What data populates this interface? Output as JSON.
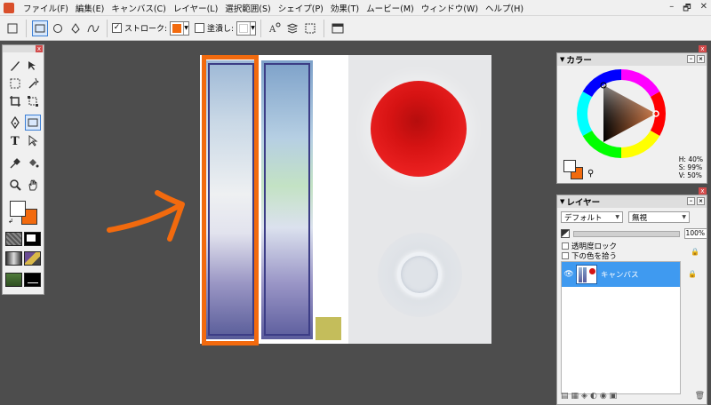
{
  "menu": {
    "items": [
      "ファイル(F)",
      "編集(E)",
      "キャンバス(C)",
      "レイヤー(L)",
      "選択範囲(S)",
      "シェイプ(P)",
      "効果(T)",
      "ムービー(M)",
      "ウィンドウ(W)",
      "ヘルプ(H)"
    ]
  },
  "window_controls": {
    "minimize": "–",
    "restore": "🗗",
    "close": "✕"
  },
  "options_bar": {
    "stroke_label": "ストローク:",
    "stroke_checked": "✓",
    "fill_label": "塗潰し:"
  },
  "colors": {
    "stroke": "#f26a0e",
    "fill": "#ffffff",
    "foreground": "#ffffff",
    "background": "#f26a0e",
    "accent_highlight": "#f26a0e",
    "selected_layer": "#3f9af0"
  },
  "color_panel": {
    "title": "カラー",
    "h": "H: 40%",
    "s": "S: 99%",
    "v": "V: 50%"
  },
  "layer_panel": {
    "title": "レイヤー",
    "preset": "デフォルト",
    "blend": "無視",
    "opacity": "100%",
    "lock_transparency": "透明度ロック",
    "pick_lower_color": "下の色を拾う",
    "layers": [
      {
        "name": "キャンバス"
      }
    ]
  },
  "icons": {
    "tools": [
      "brush-icon",
      "move-icon",
      "rect-select-icon",
      "magic-wand-icon",
      "crop-icon",
      "transform-icon",
      "pen-icon",
      "shape-icon",
      "text-icon",
      "direct-select-icon",
      "eyedropper-icon",
      "paint-bucket-icon",
      "zoom-icon",
      "hand-icon"
    ]
  }
}
